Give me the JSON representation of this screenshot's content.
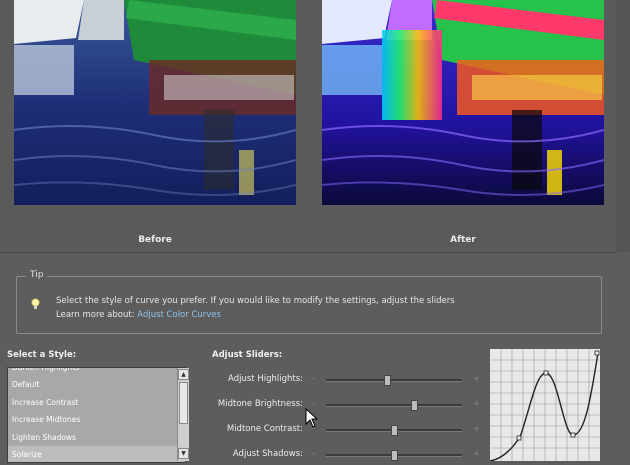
{
  "preview": {
    "before_label": "Before",
    "after_label": "After"
  },
  "tip": {
    "title": "Tip",
    "message": "Select the style of curve you prefer. If you would like to modify the settings, adjust the sliders",
    "learn_more_prefix": "Learn more about:",
    "learn_more_link": "Adjust Color Curves",
    "icon": "lightbulb-icon"
  },
  "styles": {
    "heading": "Select a Style:",
    "items": [
      "Darken Highlights",
      "Default",
      "Increase Contrast",
      "Increase Midtones",
      "Lighten Shadows",
      "Solarize"
    ],
    "selected": "Solarize"
  },
  "sliders": {
    "heading": "Adjust Sliders:",
    "items": [
      {
        "label": "Adjust Highlights:",
        "value": 0.45,
        "minus": "–",
        "plus": "+"
      },
      {
        "label": "Midtone Brightness:",
        "value": 0.65,
        "minus": "–",
        "plus": "+"
      },
      {
        "label": "Midtone Contrast:",
        "value": 0.5,
        "minus": "–",
        "plus": "+"
      },
      {
        "label": "Adjust Shadows:",
        "value": 0.5,
        "minus": "–",
        "plus": "+"
      }
    ]
  },
  "colors": {
    "panel": "#5d5d5d",
    "link": "#8ec2ea",
    "list_bg": "#a8a8a8"
  }
}
